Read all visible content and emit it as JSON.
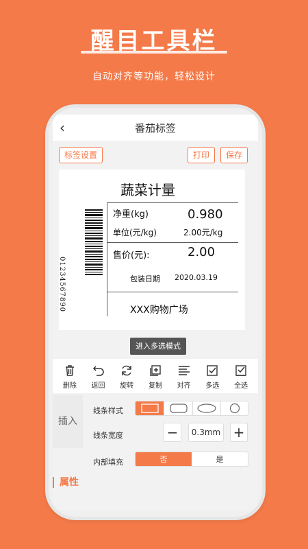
{
  "promo": {
    "headline": "醒目工具栏",
    "subtitle": "自动对齐等功能，轻松设计"
  },
  "nav": {
    "back_glyph": "‹",
    "title": "番茄标签"
  },
  "actions": {
    "label_settings": "标签设置",
    "print": "打印",
    "save": "保存"
  },
  "label": {
    "title": "蔬菜计量",
    "net_weight_label": "净重(kg)",
    "net_weight_value": "0.980",
    "unit_price_label": "单位(元/kg)",
    "unit_price_value": "2.00元/kg",
    "price_label": "售价(元):",
    "price_value": "2.00",
    "pack_date_label": "包装日期",
    "pack_date_value": "2020.03.19",
    "store": "XXX购物广场",
    "barcode_digits": "01234567890"
  },
  "multi_select_button": "进入多选模式",
  "toolbar": [
    {
      "label": "删除",
      "icon": "trash-icon"
    },
    {
      "label": "返回",
      "icon": "undo-icon"
    },
    {
      "label": "旋转",
      "icon": "rotate-icon"
    },
    {
      "label": "复制",
      "icon": "copy-icon"
    },
    {
      "label": "对齐",
      "icon": "align-icon"
    },
    {
      "label": "多选",
      "icon": "checkbox-icon"
    },
    {
      "label": "全选",
      "icon": "select-all-icon"
    }
  ],
  "panel": {
    "insert_tab": "插入",
    "line_style_label": "线条样式",
    "line_width_label": "线条宽度",
    "line_width_value": "0.3mm",
    "minus": "−",
    "plus": "+",
    "fill_label": "内部填充",
    "fill_no": "否",
    "fill_yes": "是",
    "attributes_label": "属性"
  },
  "colors": {
    "accent": "#f47a49",
    "dark_button": "#555555"
  }
}
